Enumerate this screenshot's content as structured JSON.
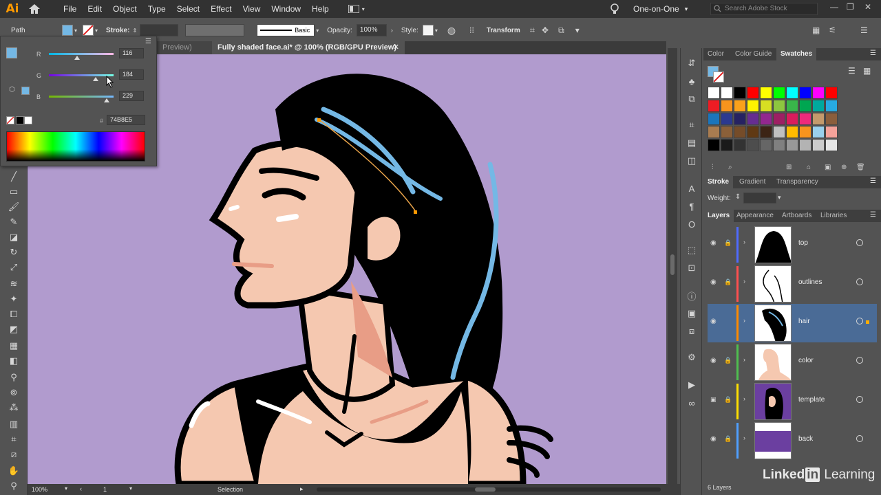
{
  "app": {
    "logo": "Ai"
  },
  "menu": [
    "File",
    "Edit",
    "Object",
    "Type",
    "Select",
    "Effect",
    "View",
    "Window",
    "Help"
  ],
  "workspace": {
    "label": "One-on-One",
    "search_placeholder": "Search Adobe Stock"
  },
  "control_bar": {
    "selection_type": "Path",
    "stroke_label": "Stroke:",
    "brush_label": "Basic",
    "opacity_label": "Opacity:",
    "opacity_value": "100%",
    "style_label": "Style:",
    "transform_label": "Transform"
  },
  "color_popup": {
    "r_label": "R",
    "r_value": "116",
    "g_label": "G",
    "g_value": "184",
    "b_label": "B",
    "b_value": "229",
    "hash": "#",
    "hex_value": "74B8E5",
    "fill_color": "#74B8E5"
  },
  "tabs": [
    {
      "label": "Preview)"
    },
    {
      "label": "Fully shaded face.ai* @ 100% (RGB/GPU Preview)"
    }
  ],
  "color_panel": {
    "tabs": [
      "Color",
      "Color Guide",
      "Swatches"
    ],
    "active_tab": "Swatches",
    "swatch_rows": [
      [
        "#ffffff",
        "#ffffff",
        "#000000",
        "#ff0000",
        "#ffff00",
        "#00ff00",
        "#00ffff",
        "#0000ff",
        "#ff00ff",
        "#ff0000"
      ],
      [
        "#ed1c24",
        "#f7941d",
        "#f9a11b",
        "#fff200",
        "#d7df23",
        "#8dc63f",
        "#39b54a",
        "#00a651",
        "#00a99d",
        "#27aae1"
      ],
      [
        "#1b75bc",
        "#2b3990",
        "#262262",
        "#662d91",
        "#92278f",
        "#9e1f63",
        "#da1c5c",
        "#ee2a7b",
        "#c49a6c",
        "#8b5e3c"
      ],
      [
        "#a97c50",
        "#8b6039",
        "#754c29",
        "#603913",
        "#3c2415",
        "#c0c0c0",
        "#ffbb00",
        "#f7941d",
        "#9ad0ec",
        "#f5a29a"
      ],
      [
        "#000000",
        "#1a1a1a",
        "#333333",
        "#4d4d4d",
        "#666666",
        "#808080",
        "#999999",
        "#b3b3b3",
        "#cccccc",
        "#e6e6e6"
      ]
    ]
  },
  "stroke_panel": {
    "tabs": [
      "Stroke",
      "Gradient",
      "Transparency"
    ],
    "active_tab": "Stroke",
    "weight_label": "Weight:"
  },
  "layers_panel": {
    "tabs": [
      "Layers",
      "Appearance",
      "Artboards",
      "Libraries"
    ],
    "active_tab": "Layers",
    "layers": [
      {
        "name": "top",
        "color": "#4f6bff",
        "selected": false
      },
      {
        "name": "outlines",
        "color": "#ff4f4f",
        "selected": false
      },
      {
        "name": "hair",
        "color": "#ff8a00",
        "selected": true
      },
      {
        "name": "color",
        "color": "#4fbf4f",
        "selected": false
      },
      {
        "name": "template",
        "color": "#ffdf00",
        "selected": false
      },
      {
        "name": "back",
        "color": "#4f9fff",
        "selected": false
      }
    ],
    "count_label": "6 Layers"
  },
  "status_bar": {
    "zoom": "100%",
    "artboard": "1",
    "tool": "Selection"
  },
  "watermark": {
    "brand_1": "Linked",
    "brand_in": "in",
    "brand_2": "Learning"
  },
  "colors": {
    "canvas_bg": "#b19bce",
    "hair_highlight": "#74B8E5",
    "skin": "#f5c8b0",
    "skin_shadow": "#e89d86"
  }
}
